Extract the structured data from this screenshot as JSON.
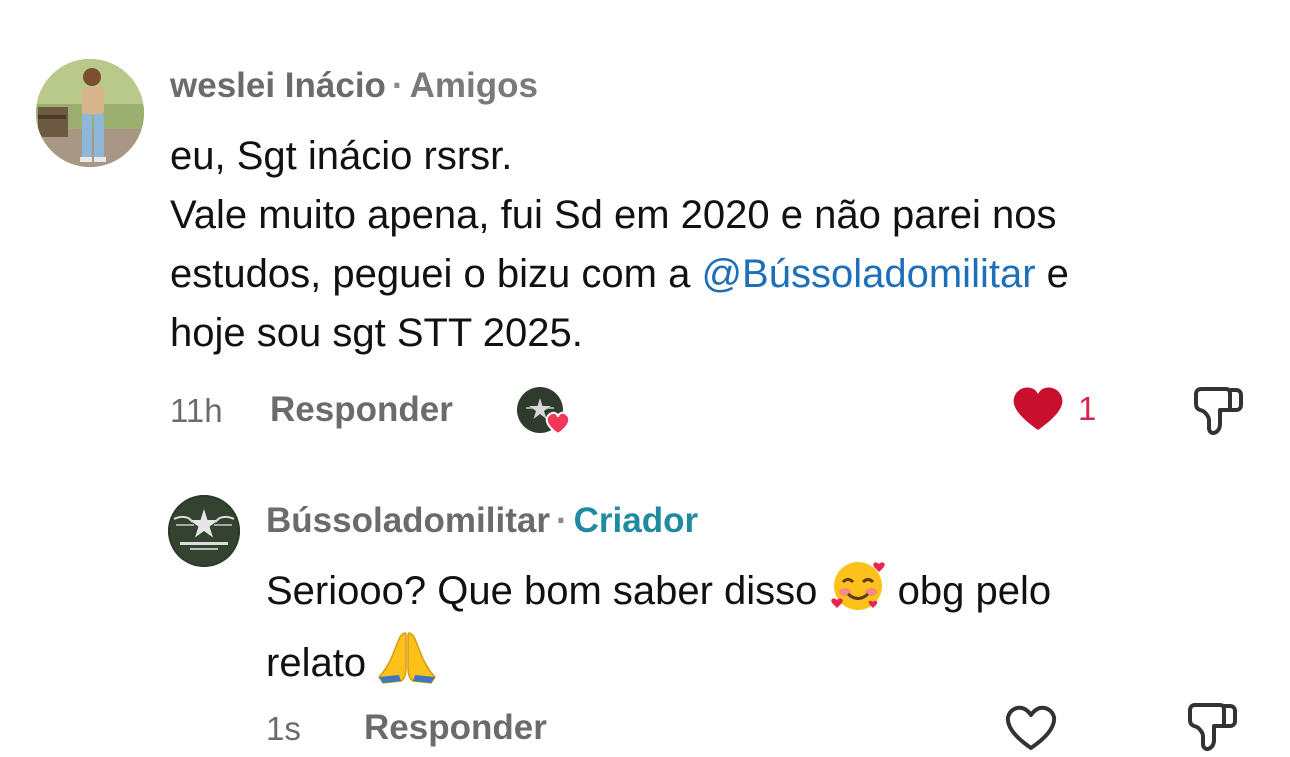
{
  "comments": [
    {
      "author": "weslei Inácio",
      "separator": "·",
      "badge": "Amigos",
      "lines": [
        "eu, Sgt inácio rsrsr.",
        "Vale muito apena, fui Sd em 2020 e não parei nos"
      ],
      "line3_before": "estudos, peguei o bizu com a ",
      "mention": "@Bússoladomilitar",
      "line3_after": " e",
      "line4": "hoje sou sgt STT 2025.",
      "time": "11h",
      "reply_label": "Responder",
      "like_count": "1",
      "liked": true,
      "creator_liked": true
    },
    {
      "author": "Bússoladomilitar",
      "separator": "·",
      "badge": "Criador",
      "line1_before_emoji": "Seriooo? Que bom saber disso ",
      "line1_after_emoji": " obg pelo",
      "line2": "relato ",
      "emoji_1": "smiling-face-with-hearts",
      "emoji_2": "folded-hands",
      "time": "1s",
      "reply_label": "Responder",
      "liked": false
    }
  ],
  "colors": {
    "meta_gray": "#6b6b6b",
    "mention_blue": "#1d6fb8",
    "creator_teal": "#1f8aa0",
    "like_red": "#d3264d"
  }
}
